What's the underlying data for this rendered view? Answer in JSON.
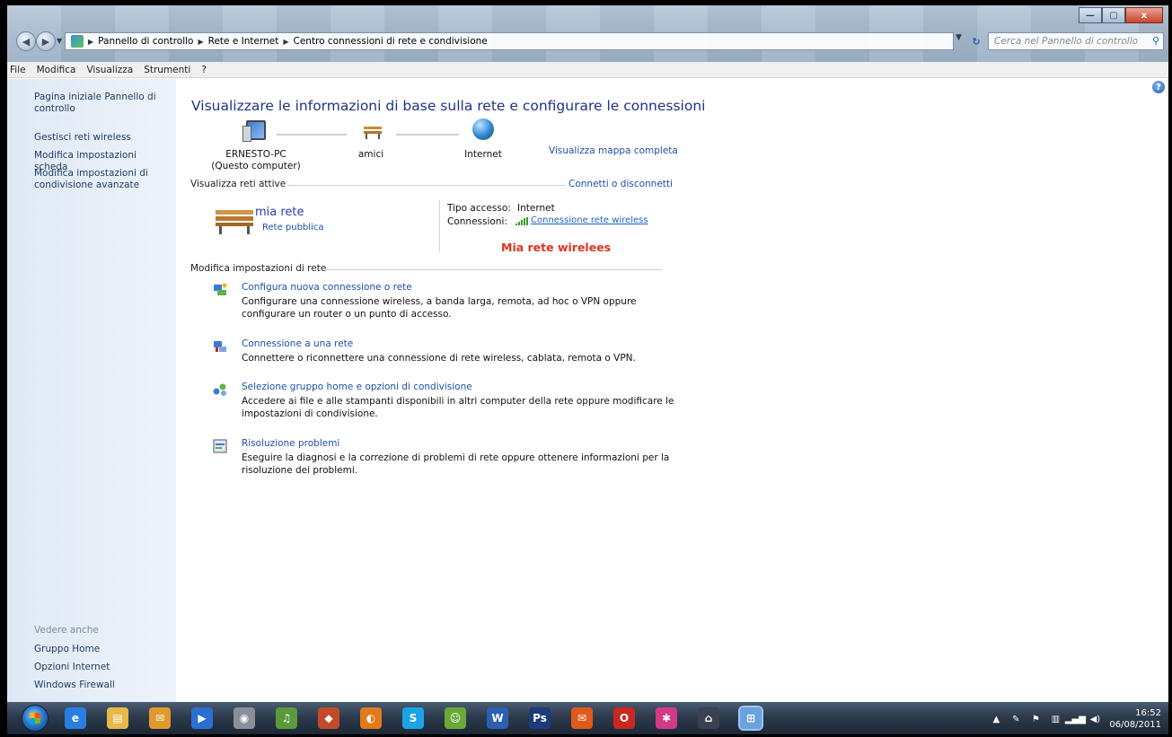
{
  "window": {
    "minimize_label": "—",
    "maximize_label": "▢",
    "close_label": "x"
  },
  "address_bar": {
    "crumbs": [
      "Pannello di controllo",
      "Rete e Internet",
      "Centro connessioni di rete e condivisione"
    ]
  },
  "search": {
    "placeholder": "Cerca nel Pannello di controllo"
  },
  "menu": {
    "items": [
      "File",
      "Modifica",
      "Visualizza",
      "Strumenti",
      "?"
    ]
  },
  "sidebar": {
    "home_line1": "Pagina iniziale Pannello di",
    "home_line2": "controllo",
    "links": [
      "Gestisci reti wireless",
      "Modifica impostazioni scheda"
    ],
    "advanced_line1": "Modifica impostazioni di",
    "advanced_line2": "condivisione avanzate",
    "see_also": "Vedere anche",
    "see_also_links": [
      "Gruppo Home",
      "Opzioni Internet",
      "Windows Firewall"
    ]
  },
  "main": {
    "title": "Visualizzare le informazioni di base sulla rete e configurare le connessioni",
    "map_link": "Visualizza mappa completa",
    "nodes": {
      "computer_name": "ERNESTO-PC",
      "computer_sub": "(Questo computer)",
      "network": "amici",
      "internet": "Internet"
    },
    "active_networks_header": "Visualizza reti attive",
    "connect_link": "Connetti o disconnetti",
    "network_name": "mia rete",
    "network_type": "Rete pubblica",
    "access_type_label": "Tipo accesso:",
    "access_type_value": "Internet",
    "connections_label": "Connessioni:",
    "connection_link": "Connessione rete wireless",
    "red_note": "Mia rete wirelees",
    "settings_header": "Modifica impostazioni di rete",
    "tasks": [
      {
        "link": "Configura nuova connessione o rete",
        "desc": "Configurare una connessione wireless, a banda larga, remota, ad hoc o VPN oppure configurare un router o un punto di accesso."
      },
      {
        "link": "Connessione a una rete",
        "desc": "Connettere o riconnettere una connessione di rete wireless, cablata, remota o VPN."
      },
      {
        "link": "Selezione gruppo home e opzioni di condivisione",
        "desc": "Accedere ai file e alle stampanti disponibili in altri computer della rete oppure modificare le impostazioni di condivisione."
      },
      {
        "link": "Risoluzione problemi",
        "desc": "Eseguire la diagnosi e la correzione di problemi di rete oppure ottenere informazioni per la risoluzione dei problemi."
      }
    ]
  },
  "taskbar": {
    "apps": [
      {
        "icon": "ie-icon",
        "glyph": "e",
        "color": "#2a7de1"
      },
      {
        "icon": "explorer-icon",
        "glyph": "▤",
        "color": "#e8b84a"
      },
      {
        "icon": "mail-app-icon",
        "glyph": "✉",
        "color": "#e09a2b"
      },
      {
        "icon": "media-player-icon",
        "glyph": "▶",
        "color": "#2a6fd1"
      },
      {
        "icon": "camera-icon",
        "glyph": "◉",
        "color": "#8a8f99"
      },
      {
        "icon": "music-app-icon",
        "glyph": "♫",
        "color": "#5a9a3a"
      },
      {
        "icon": "game-icon",
        "glyph": "◆",
        "color": "#c24a2a"
      },
      {
        "icon": "browser-icon",
        "glyph": "◐",
        "color": "#e07a1a"
      },
      {
        "icon": "skype-icon",
        "glyph": "S",
        "color": "#1ba3e8"
      },
      {
        "icon": "messenger-icon",
        "glyph": "☺",
        "color": "#6aa83a"
      },
      {
        "icon": "word-icon",
        "glyph": "W",
        "color": "#2b5fb4"
      },
      {
        "icon": "photoshop-icon",
        "glyph": "Ps",
        "color": "#1b3b7a"
      },
      {
        "icon": "email-icon",
        "glyph": "✉",
        "color": "#e05a1a"
      },
      {
        "icon": "opera-icon",
        "glyph": "O",
        "color": "#c8281e"
      },
      {
        "icon": "pinwheel-icon",
        "glyph": "✱",
        "color": "#d23a8a"
      },
      {
        "icon": "penguin-icon",
        "glyph": "⌂",
        "color": "#3a4250"
      },
      {
        "icon": "control-panel-icon",
        "glyph": "⊞",
        "color": "#6aa2e0"
      }
    ],
    "clock_time": "16:52",
    "clock_date": "06/08/2011"
  }
}
